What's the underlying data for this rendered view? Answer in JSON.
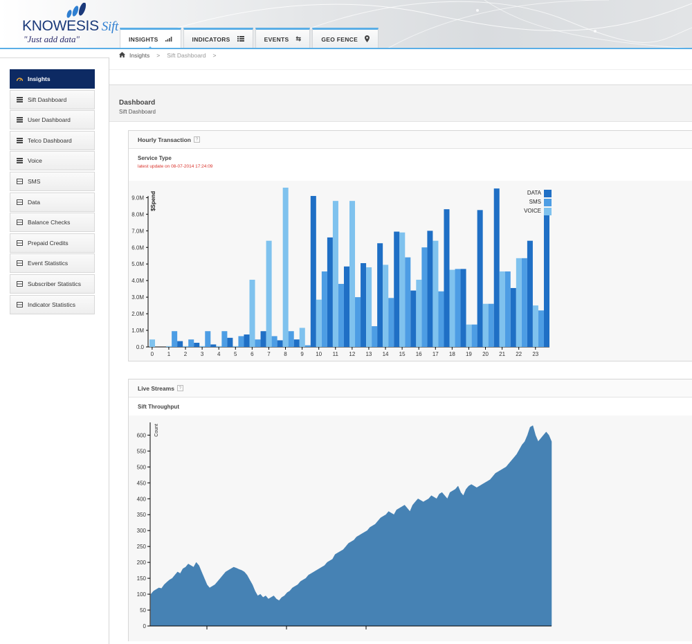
{
  "app": {
    "brand": "KNOWESIS",
    "brand_product": "Sift",
    "tagline": "\"Just add data\""
  },
  "nav": {
    "tabs": [
      {
        "label": "INSIGHTS",
        "icon": "signal-bars-icon"
      },
      {
        "label": "INDICATORS",
        "icon": "list-icon"
      },
      {
        "label": "EVENTS",
        "icon": "retweet-icon"
      },
      {
        "label": "GEO FENCE",
        "icon": "map-marker-icon"
      }
    ]
  },
  "breadcrumb": {
    "home": "Insights",
    "current": "Sift Dashboard",
    "sep": ">"
  },
  "sidebar": {
    "items": [
      {
        "label": "Insights",
        "icon": "dashboard-icon",
        "active": true
      },
      {
        "label": "Sift Dashboard",
        "icon": "list-icon"
      },
      {
        "label": "User Dashboard",
        "icon": "list-icon"
      },
      {
        "label": "Telco Dashboard",
        "icon": "list-icon"
      },
      {
        "label": "Voice",
        "icon": "list-icon"
      },
      {
        "label": "SMS",
        "icon": "bar-chart-icon"
      },
      {
        "label": "Data",
        "icon": "bar-chart-icon"
      },
      {
        "label": "Balance Checks",
        "icon": "bar-chart-icon"
      },
      {
        "label": "Prepaid Credits",
        "icon": "bar-chart-icon"
      },
      {
        "label": "Event Statistics",
        "icon": "bar-chart-icon"
      },
      {
        "label": "Subscriber Statistics",
        "icon": "bar-chart-icon"
      },
      {
        "label": "Indicator Statistics",
        "icon": "bar-chart-icon"
      }
    ]
  },
  "page": {
    "title": "Dashboard",
    "subtitle": "Sift Dashboard"
  },
  "panels": {
    "hourly": {
      "title": "Hourly Transaction",
      "chart_title": "Service Type",
      "updated": "latest update on 08-07-2014 17:24:09"
    },
    "live": {
      "title": "Live Streams",
      "chart_title": "Sift Throughput"
    }
  },
  "colors": {
    "accent": "#5aaee6",
    "sidebar_active": "#0d2a63",
    "data": "#1f6fc5",
    "sms": "#4d9de4",
    "voice": "#7fc2ee",
    "area": "#4682b4",
    "update_text": "#d9322b"
  },
  "chart_data": [
    {
      "type": "bar",
      "title": "Service Type",
      "ylabel": "$Spend",
      "xlabel": "",
      "categories": [
        "0",
        "1",
        "2",
        "3",
        "4",
        "5",
        "6",
        "7",
        "8",
        "9",
        "10",
        "11",
        "12",
        "13",
        "14",
        "15",
        "16",
        "17",
        "18",
        "19",
        "20",
        "21",
        "22",
        "23"
      ],
      "yticks": [
        "0.0",
        "1.0M",
        "2.0M",
        "3.0M",
        "4.0M",
        "5.0M",
        "6.0M",
        "7.0M",
        "8.0M",
        "9.0M"
      ],
      "ylim": [
        0,
        9600000
      ],
      "legend": "top-right",
      "series": [
        {
          "name": "VOICE",
          "values": [
            450000,
            50000,
            50000,
            50000,
            50000,
            50000,
            4050000,
            6400000,
            9600000,
            1150000,
            2850000,
            8800000,
            8800000,
            4800000,
            4950000,
            6900000,
            4050000,
            6400000,
            4650000,
            1350000,
            2600000,
            4550000,
            5350000,
            2500000
          ]
        },
        {
          "name": "SMS",
          "values": [
            0,
            950000,
            450000,
            950000,
            950000,
            650000,
            450000,
            650000,
            950000,
            100000,
            4550000,
            3800000,
            3000000,
            1250000,
            2950000,
            5400000,
            6000000,
            3350000,
            4700000,
            1350000,
            2600000,
            4550000,
            5350000,
            2200000
          ]
        },
        {
          "name": "DATA",
          "values": [
            0,
            350000,
            250000,
            150000,
            550000,
            750000,
            950000,
            400000,
            450000,
            9100000,
            6600000,
            4850000,
            5050000,
            6250000,
            6950000,
            3400000,
            7000000,
            8300000,
            4700000,
            8250000,
            9550000,
            3550000,
            6400000,
            8100000
          ]
        }
      ]
    },
    {
      "type": "area",
      "title": "Sift Throughput",
      "ylabel": "Count",
      "xlabel": "",
      "yticks": [
        "0",
        "50",
        "100",
        "150",
        "200",
        "250",
        "300",
        "350",
        "400",
        "450",
        "500",
        "550",
        "600"
      ],
      "ylim": [
        0,
        640
      ],
      "x": [
        0,
        2,
        4,
        6,
        8,
        10,
        12,
        14,
        16,
        18,
        20,
        22,
        24,
        26,
        28,
        30,
        32,
        34,
        36,
        38,
        40,
        42,
        44,
        46,
        48,
        50,
        52,
        54,
        56,
        58,
        60,
        62,
        64,
        66,
        68,
        70,
        72,
        74,
        76,
        78,
        80,
        82,
        84,
        86,
        88,
        90,
        92,
        94,
        96,
        98,
        100,
        102,
        104,
        106,
        108,
        110,
        112,
        114,
        116,
        118,
        120,
        122,
        124,
        126,
        128,
        130,
        132,
        134,
        136,
        138,
        140,
        142,
        144,
        146,
        148,
        150,
        152,
        154,
        156,
        158,
        160,
        162,
        164,
        166,
        168,
        170,
        172,
        174,
        176,
        178,
        180,
        182,
        184,
        186,
        188,
        190,
        192,
        194,
        196,
        198,
        200,
        202,
        204,
        206,
        208,
        210,
        212,
        214,
        216,
        218,
        220,
        222,
        224,
        226,
        228,
        230,
        232,
        234,
        236,
        238,
        240,
        242,
        244,
        246,
        248,
        250,
        252,
        254,
        256,
        258,
        260,
        262,
        264,
        266,
        268,
        270,
        272,
        274,
        276,
        278,
        280,
        282,
        284,
        286,
        288,
        290,
        292,
        294,
        296,
        298,
        300
      ],
      "values": [
        100,
        110,
        115,
        120,
        118,
        130,
        138,
        145,
        150,
        160,
        170,
        165,
        180,
        185,
        195,
        190,
        185,
        200,
        190,
        170,
        150,
        130,
        120,
        125,
        130,
        140,
        150,
        160,
        170,
        175,
        180,
        185,
        182,
        178,
        175,
        170,
        160,
        145,
        130,
        110,
        95,
        100,
        90,
        95,
        85,
        90,
        95,
        85,
        80,
        90,
        95,
        105,
        110,
        120,
        125,
        130,
        140,
        145,
        150,
        160,
        165,
        170,
        175,
        180,
        185,
        190,
        200,
        205,
        210,
        225,
        230,
        235,
        240,
        250,
        260,
        265,
        270,
        280,
        285,
        290,
        295,
        300,
        310,
        315,
        320,
        330,
        340,
        345,
        350,
        360,
        355,
        350,
        365,
        370,
        375,
        380,
        370,
        360,
        380,
        390,
        400,
        395,
        390,
        395,
        400,
        410,
        405,
        400,
        415,
        420,
        410,
        400,
        420,
        425,
        430,
        440,
        420,
        410,
        430,
        440,
        445,
        440,
        435,
        440,
        445,
        450,
        455,
        460,
        470,
        480,
        485,
        490,
        495,
        500,
        510,
        520,
        530,
        540,
        555,
        570,
        580,
        600,
        625,
        630,
        600,
        580,
        590,
        600,
        610,
        600,
        580
      ]
    }
  ]
}
